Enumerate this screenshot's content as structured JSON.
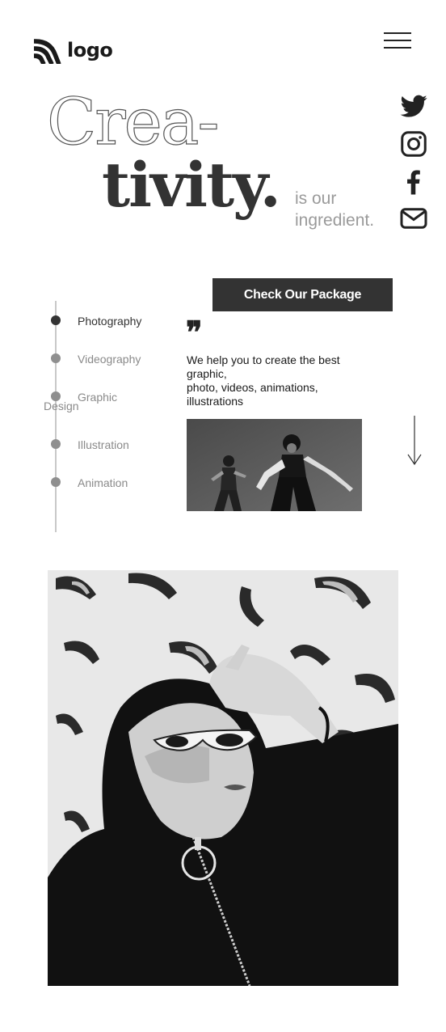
{
  "header": {
    "logo_text": "logo",
    "logo_icon": "signal-wave-icon",
    "menu_icon": "hamburger-menu-icon"
  },
  "hero": {
    "word_part1": "Crea-",
    "word_part2": "tivity.",
    "tagline_line1": "is our",
    "tagline_line2": "ingredient."
  },
  "social": [
    {
      "icon": "twitter-icon"
    },
    {
      "icon": "instagram-icon"
    },
    {
      "icon": "facebook-icon"
    },
    {
      "icon": "mail-icon"
    }
  ],
  "package_button": {
    "label": "Check Our Package"
  },
  "services": [
    {
      "label": "Photography",
      "active": true
    },
    {
      "label": "Videography",
      "active": false
    },
    {
      "label": "Graphic Design",
      "label_line1": "Graphic",
      "label_line2": "Design",
      "active": false
    },
    {
      "label": "Illustration",
      "active": false
    },
    {
      "label": "Animation",
      "active": false
    }
  ],
  "quote": {
    "mark": "❞",
    "text_line1": "We help you to create the best",
    "text_line2": "graphic,",
    "text_line3": "photo, videos, animations,",
    "text_line4": "illustrations"
  },
  "images": {
    "dancers": "black-and-white photo of two dancers",
    "portrait": "black-and-white portrait of woman in hood and white sunglasses"
  },
  "scroll_icon": "arrow-down-icon",
  "colors": {
    "dark": "#333333",
    "muted": "#8f8f8f",
    "background": "#ffffff"
  }
}
